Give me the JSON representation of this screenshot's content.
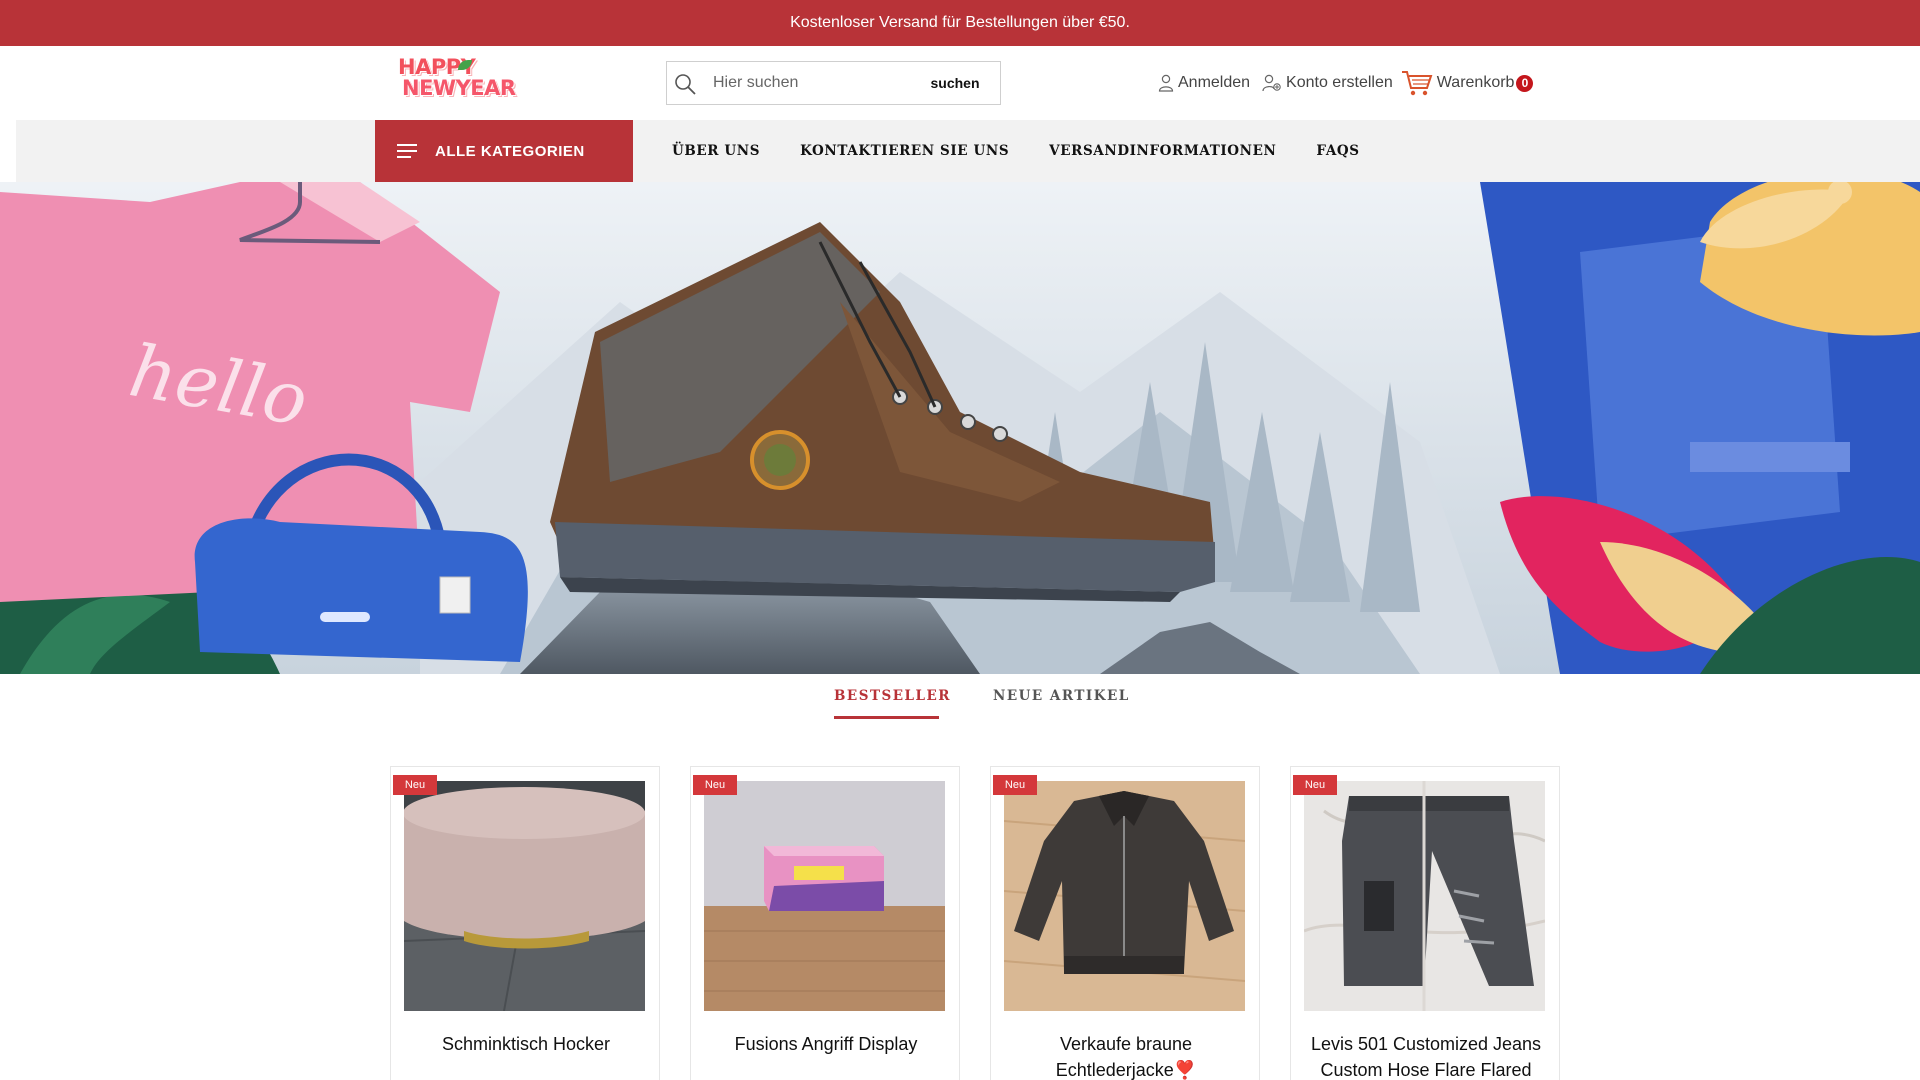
{
  "announcement": "Kostenloser Versand für Bestellungen über €50.",
  "logo": {
    "line1": "HAPPY",
    "line2": "NEWYEAR"
  },
  "search": {
    "placeholder": "Hier suchen",
    "button_label": "suchen"
  },
  "account": {
    "login_label": "Anmelden",
    "register_label": "Konto erstellen",
    "cart_label": "Warenkorb",
    "cart_count": "0"
  },
  "nav": {
    "all_categories_label": "ALLE KATEGORIEN",
    "items": [
      {
        "label": "ÜBER UNS"
      },
      {
        "label": "KONTAKTIEREN SIE UNS"
      },
      {
        "label": "VERSANDINFORMATIONEN"
      },
      {
        "label": "FAQS"
      }
    ]
  },
  "hero": {
    "shirt_text": "hello"
  },
  "tabs": [
    {
      "label": "BESTSELLER",
      "active": true
    },
    {
      "label": "NEUE ARTIKEL",
      "active": false
    }
  ],
  "products": [
    {
      "badge": "Neu",
      "name": "Schminktisch Hocker"
    },
    {
      "badge": "Neu",
      "name": "Fusions Angriff Display"
    },
    {
      "badge": "Neu",
      "name": "Verkaufe braune Echtlederjacke❣️"
    },
    {
      "badge": "Neu",
      "name": "Levis 501 Customized Jeans Custom Hose Flare Flared"
    }
  ],
  "colors": {
    "brand": "#b83338",
    "badge": "#d4383b",
    "cart_badge": "#c4161c"
  }
}
